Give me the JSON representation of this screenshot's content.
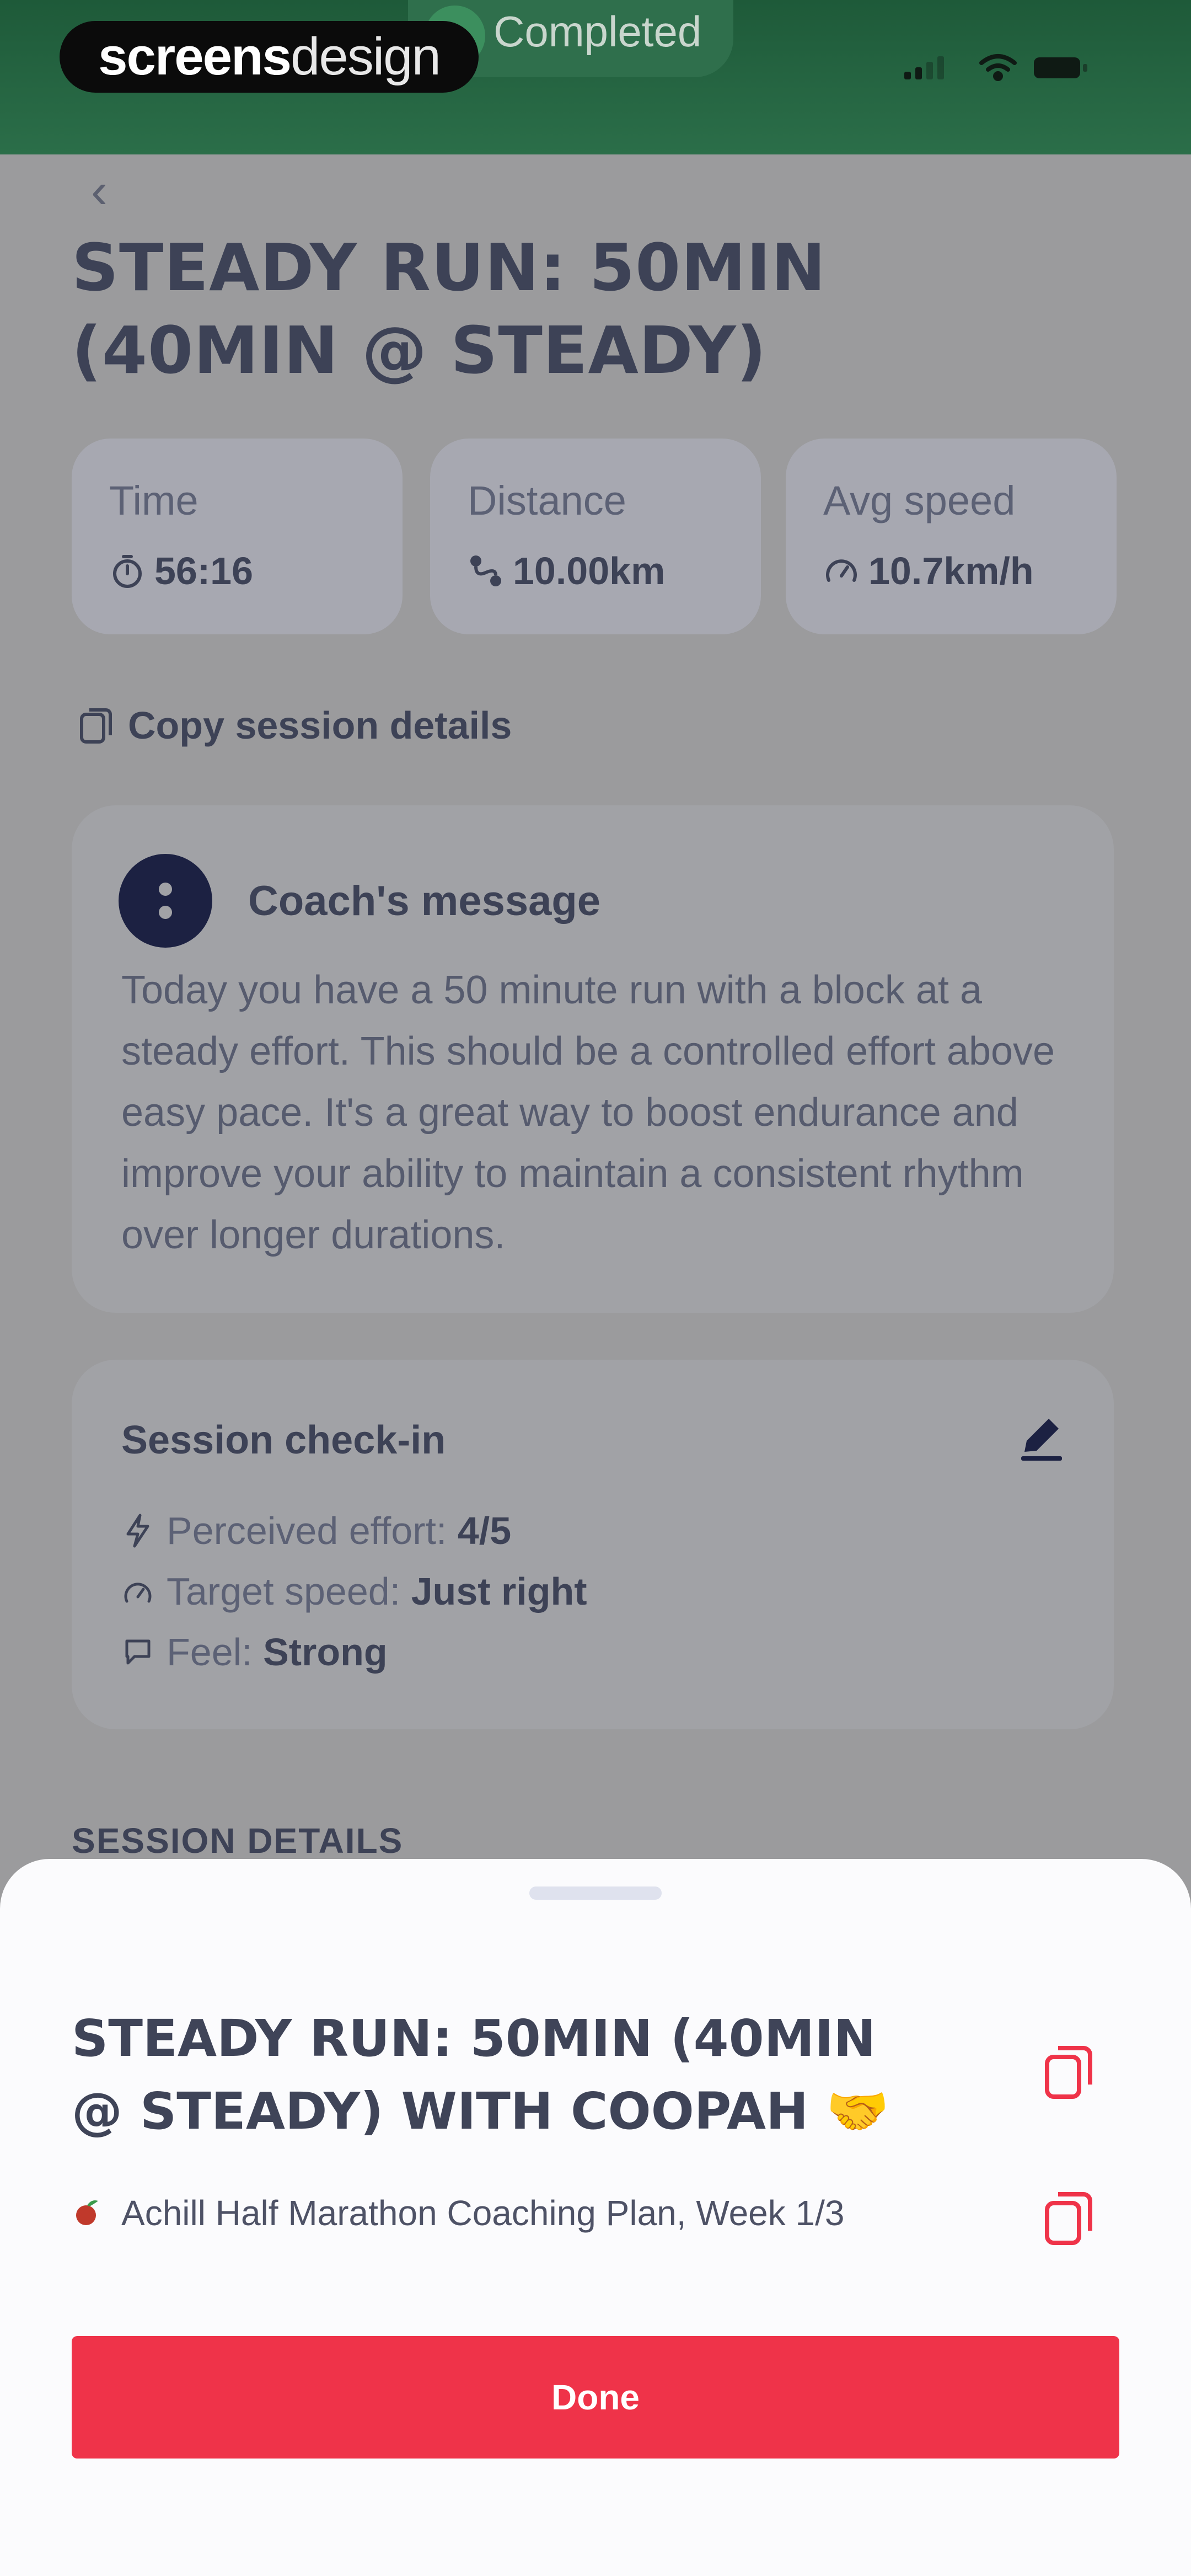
{
  "status_bar": {
    "brand_bold": "screens",
    "brand_regular": "design",
    "status_text": "Completed"
  },
  "page": {
    "title": "STEADY RUN: 50MIN (40MIN @ STEADY)",
    "stats": [
      {
        "label": "Time",
        "value": "56:16",
        "icon": "stopwatch-icon"
      },
      {
        "label": "Distance",
        "value": "10.00km",
        "icon": "route-icon"
      },
      {
        "label": "Avg speed",
        "value": "10.7km/h",
        "icon": "speedometer-icon"
      }
    ],
    "copy_session_label": "Copy session details",
    "coach": {
      "title": "Coach's message",
      "body": "Today you have a 50 minute run with a block at a steady effort. This should be a controlled effort above easy pace. It's a great way to boost endurance and improve your ability to maintain a consistent rhythm over longer durations."
    },
    "checkin": {
      "title": "Session check-in",
      "rows": [
        {
          "label": "Perceived effort: ",
          "value": "4/5",
          "icon": "lightning-icon"
        },
        {
          "label": "Target speed: ",
          "value": "Just right",
          "icon": "speedometer-icon"
        },
        {
          "label": "Feel: ",
          "value": "Strong",
          "icon": "chat-icon"
        }
      ]
    },
    "section_label": "SESSION DETAILS"
  },
  "sheet": {
    "title": "STEADY RUN: 50MIN (40MIN @ STEADY) WITH COOPAH 🤝",
    "plan": "Achill Half Marathon Coaching Plan, Week 1/3",
    "done_label": "Done"
  },
  "colors": {
    "accent": "#EF3349",
    "status_green": "#1E5A39",
    "navy": "#1C2142"
  }
}
